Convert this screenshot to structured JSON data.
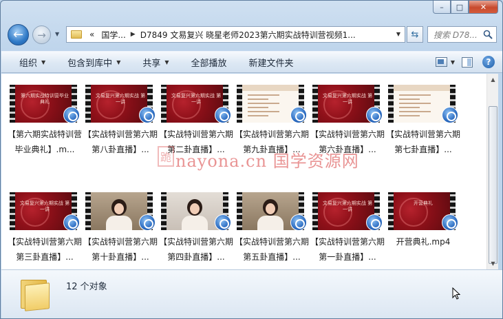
{
  "window": {
    "controls": [
      "–",
      "□",
      "✕"
    ]
  },
  "nav": {
    "back_glyph": "←",
    "forward_glyph": "→",
    "breadcrumb": [
      "«",
      "国学...",
      "D7849 文易复兴 晓星老师2023第六期实战特训营视频1..."
    ],
    "refresh_glyph": "⇆",
    "search_placeholder": "搜索 D78..."
  },
  "toolbar": {
    "organize": "组织",
    "include_library": "包含到库中",
    "share": "共享",
    "play_all": "全部播放",
    "new_folder": "新建文件夹"
  },
  "files": [
    {
      "name": "【第六期实战特训营毕业典礼】.m...",
      "thumb": "red",
      "caption": "第六期实战特训营毕业典礼"
    },
    {
      "name": "【实战特训营第六期第八卦直播】...",
      "thumb": "red",
      "caption": "文易复兴第六期实战 第一讲"
    },
    {
      "name": "【实战特训营第六期第二卦直播】...",
      "thumb": "red",
      "caption": "文易复兴第六期实战 第一讲"
    },
    {
      "name": "【实战特训营第六期第九卦直播】...",
      "thumb": "doc",
      "caption": ""
    },
    {
      "name": "【实战特训营第六期第六卦直播】...",
      "thumb": "red",
      "caption": "文易复兴第六期实战 第一讲"
    },
    {
      "name": "【实战特训营第六期第七卦直播】...",
      "thumb": "doc",
      "caption": ""
    },
    {
      "name": "【实战特训营第六期第三卦直播】...",
      "thumb": "red",
      "caption": "文易复兴第六期实战 第一讲"
    },
    {
      "name": "【实战特训营第六期第十卦直播】...",
      "thumb": "room",
      "caption": ""
    },
    {
      "name": "【实战特训营第六期第四卦直播】...",
      "thumb": "face",
      "caption": ""
    },
    {
      "name": "【实战特训营第六期第五卦直播】...",
      "thumb": "room",
      "caption": ""
    },
    {
      "name": "【实战特训营第六期第一卦直播】...",
      "thumb": "red",
      "caption": "文易复兴第六期实战 第一讲"
    },
    {
      "name": "开营典礼.mp4",
      "thumb": "red",
      "caption": "开营典礼"
    }
  ],
  "watermark": {
    "seal": "跪",
    "text": "nayona.cn 国学资源网"
  },
  "status": {
    "count": "12 个对象"
  }
}
